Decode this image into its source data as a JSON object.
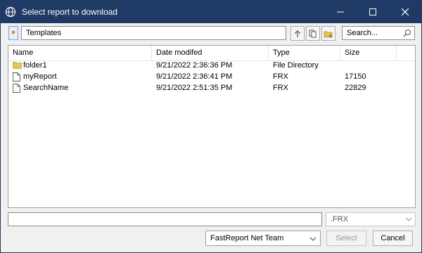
{
  "window": {
    "title": "Select report to download",
    "accent_color": "#1f3a64",
    "controls": {
      "minimize": "minimize-icon",
      "maximize": "maximize-icon",
      "close": "close-icon"
    }
  },
  "toolbar": {
    "path_value": "Templates",
    "search_placeholder": "Search..."
  },
  "list": {
    "columns": [
      "Name",
      "Date modifed",
      "Type",
      "Size"
    ],
    "rows": [
      {
        "icon": "folder-icon",
        "name": "folder1",
        "date": "9/21/2022 2:36:36 PM",
        "type": "File Directory",
        "size": ""
      },
      {
        "icon": "file-icon",
        "name": "myReport",
        "date": "9/21/2022 2:36:41 PM",
        "type": "FRX",
        "size": "17150"
      },
      {
        "icon": "file-icon",
        "name": "SearchName",
        "date": "9/21/2022 2:51:35 PM",
        "type": "FRX",
        "size": "22829"
      }
    ]
  },
  "footer": {
    "filename_value": "",
    "filter_value": ".FRX",
    "team_value": "FastReport Net Team",
    "select_label": "Select",
    "cancel_label": "Cancel"
  }
}
